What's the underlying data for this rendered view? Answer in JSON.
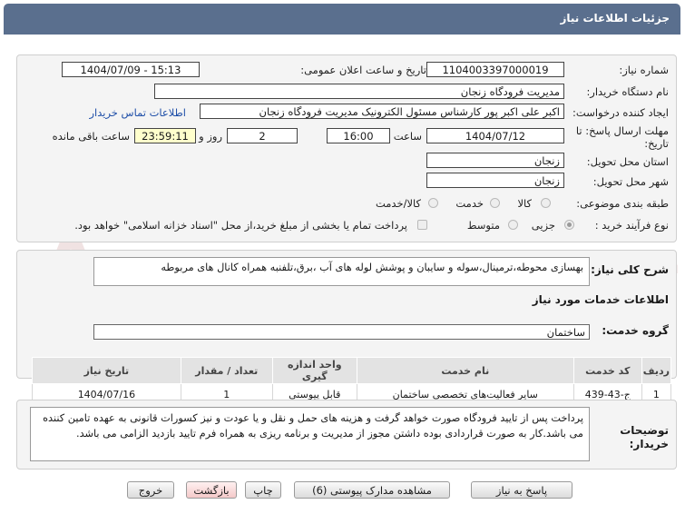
{
  "title": "جزئیات اطلاعات نیاز",
  "watermark": "AriaTender.net",
  "info": {
    "need_number_label": "شماره نیاز:",
    "need_number": "1104003397000019",
    "announce_label": "تاریخ و ساعت اعلان عمومی:",
    "announce_value": "1404/07/09 - 15:13",
    "buyer_org_label": "نام دستگاه خریدار:",
    "buyer_org": "مدیریت فرودگاه زنجان",
    "creator_label": "ایجاد کننده درخواست:",
    "creator": "اکبر علی اکبر پور کارشناس مسئول الکترونیک مدیریت فرودگاه زنجان",
    "contact_link": "اطلاعات تماس خریدار",
    "deadline_label": "مهلت ارسال پاسخ: تا تاریخ:",
    "deadline_date": "1404/07/12",
    "time_label": "ساعت",
    "deadline_time": "16:00",
    "days_value": "2",
    "days_label": "روز و",
    "remaining_time": "23:59:11",
    "remaining_label": "ساعت باقی مانده",
    "province_label": "استان محل تحویل:",
    "province": "زنجان",
    "city_label": "شهر محل تحویل:",
    "city": "زنجان",
    "category_label": "طبقه بندی موضوعی:",
    "category_options": [
      "کالا",
      "خدمت",
      "کالا/خدمت"
    ],
    "process_label": "نوع فرآیند خرید :",
    "process_options": [
      "جزیی",
      "متوسط"
    ],
    "payment_note": "پرداخت تمام یا بخشی از مبلغ خرید،از محل \"اسناد خزانه اسلامی\" خواهد بود."
  },
  "summary": {
    "label": "شرح کلی نیاز:",
    "text": "بهسازی محوطه،ترمینال،سوله و سایبان و پوشش لوله های آب ،برق،تلفنبه همراه کانال های مربوطه"
  },
  "services": {
    "section_title": "اطلاعات خدمات مورد نیاز",
    "group_label": "گروه خدمت:",
    "group_value": "ساختمان",
    "columns": [
      "ردیف",
      "کد خدمت",
      "نام خدمت",
      "واحد اندازه گیری",
      "تعداد / مقدار",
      "تاریخ نیاز"
    ],
    "rows": [
      {
        "row": "1",
        "code": "ج-43-439",
        "name": "سایر فعالیت‌های تخصصی ساختمان",
        "unit": "قابل پیوستی",
        "qty": "1",
        "date": "1404/07/16"
      }
    ]
  },
  "buyer_notes": {
    "label": "توضیحات خریدار:",
    "text": "پرداخت پس از تایید فرودگاه صورت خواهد گرفت و هزینه های حمل و نقل و یا عودت و نیز کسورات قانونی به عهده تامین کننده می باشد.کار به صورت قراردادی بوده داشتن مجوز از مدیریت و برنامه ریزی به همراه فرم تایید بازدید الزامی می باشد."
  },
  "buttons": {
    "reply": "پاسخ به نیاز",
    "attachments": "مشاهده مدارک پیوستی (6)",
    "print": "چاپ",
    "back": "بازگشت",
    "exit": "خروج"
  }
}
